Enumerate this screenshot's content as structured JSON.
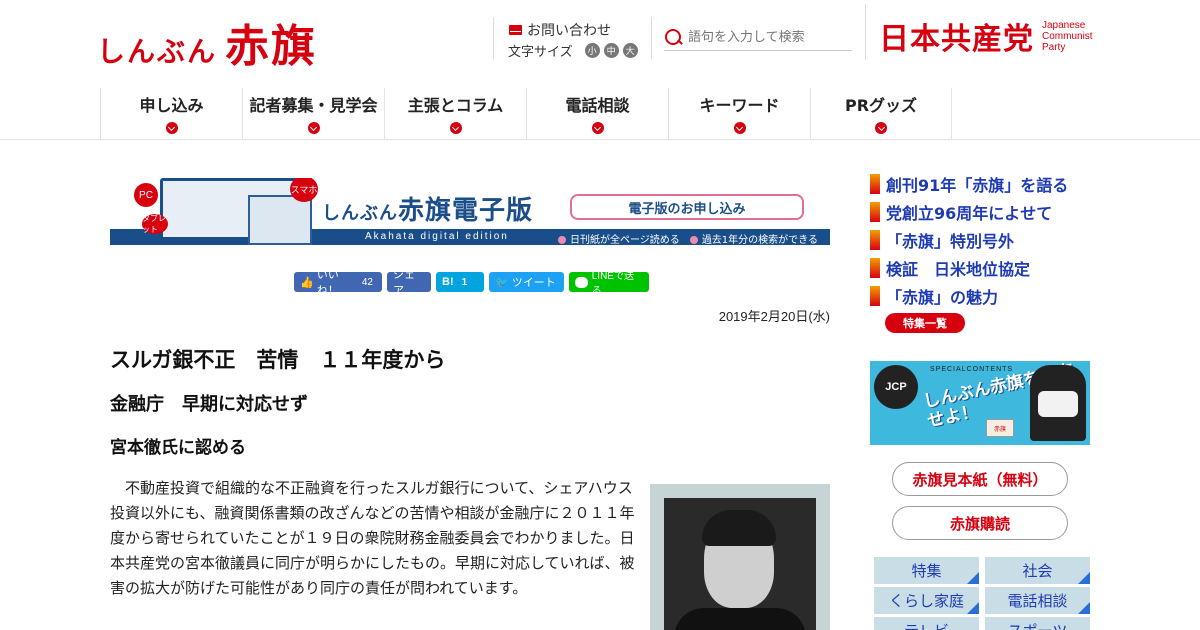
{
  "header": {
    "logo_small": "しんぶん",
    "logo_big": "赤旗",
    "contact_label": "お問い合わせ",
    "fontsize_label": "文字サイズ",
    "fontsize_options": [
      "小",
      "中",
      "大"
    ],
    "search_placeholder": "語句を入力して検索",
    "party_name": "日本共産党",
    "party_en_1": "Japanese",
    "party_en_2": "Communist",
    "party_en_3": "Party"
  },
  "nav": {
    "items": [
      {
        "label": "申し込み"
      },
      {
        "label": "記者募集・見学会"
      },
      {
        "label": "主張とコラム"
      },
      {
        "label": "電話相談"
      },
      {
        "label": "キーワード"
      },
      {
        "label": "PRグッズ"
      }
    ]
  },
  "banner": {
    "pc": "PC",
    "tablet": "タブレット",
    "smartphone": "スマホ",
    "title_small": "しんぶん",
    "title_big": "赤旗電子版",
    "subtitle": "Akahata digital edition",
    "apply": "電子版のお申し込み",
    "bullet1": "日刊紙が全ページ読める",
    "bullet2": "過去1年分の検索ができる"
  },
  "social": {
    "like": "いいね！",
    "like_count": "42",
    "share": "シェア",
    "hatena": "B!",
    "hatena_count": "1",
    "tweet": "ツイート",
    "line": "LINEで送る"
  },
  "article": {
    "date": "2019年2月20日(水)",
    "title": "スルガ銀不正　苦情　１１年度から",
    "subtitle1": "金融庁　早期に対応せず",
    "subtitle2": "宮本徹氏に認める",
    "body": "　不動産投資で組織的な不正融資を行ったスルガ銀行について、シェアハウス投資以外にも、融資関係書類の改ざんなどの苦情や相談が金融庁に２０１１年度から寄せられていたことが１９日の衆院財務金融委員会でわかりました。日本共産党の宮本徹議員に同庁が明らかにしたもの。早期に対応していれば、被害の拡大が防げた可能性があり同庁の責任が問われています。"
  },
  "sidebar": {
    "links": [
      {
        "label": "創刊91年「赤旗」を語る"
      },
      {
        "label": "党創立96周年によせて"
      },
      {
        "label": "「赤旗」特別号外"
      },
      {
        "label": "検証　日米地位協定"
      },
      {
        "label": "「赤旗」の魅力"
      }
    ],
    "features_button": "特集一覧",
    "special_circle": "JCP",
    "special_small": "SPECIALCONTENTS",
    "special_text": "しんぶん赤旗を調査せよ！",
    "special_box": "赤旗",
    "sample": "赤旗見本紙（無料）",
    "subscribe": "赤旗購読",
    "categories": [
      {
        "label": "特集"
      },
      {
        "label": "社会"
      },
      {
        "label": "くらし家庭"
      },
      {
        "label": "電話相談"
      },
      {
        "label": "テレビ"
      },
      {
        "label": "スポーツ"
      }
    ]
  },
  "colors": {
    "brand_red": "#d7000f",
    "link_blue": "#1f3bb3",
    "banner_blue": "#1a4e8a"
  }
}
